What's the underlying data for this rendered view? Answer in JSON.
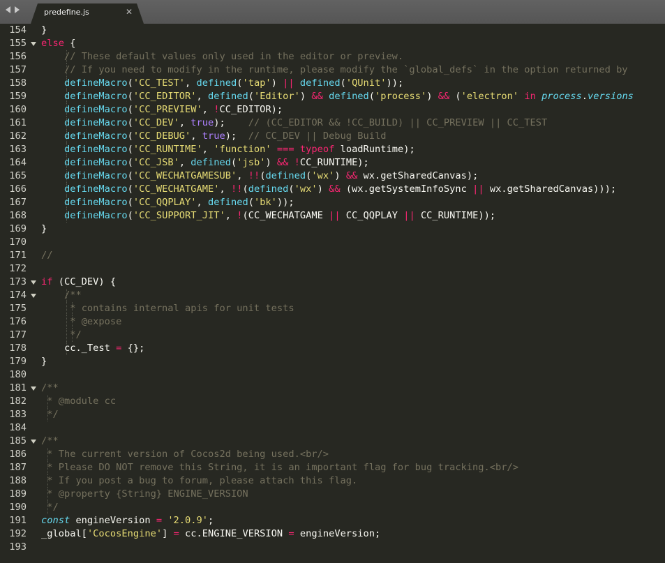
{
  "tab": {
    "title": "predefine.js"
  },
  "colors": {
    "background": "#272822",
    "keyword": "#f92672",
    "string": "#e6db74",
    "comment": "#75715e",
    "function": "#66d9ef",
    "constant": "#ae81ff",
    "text": "#f8f8f2"
  },
  "icons": [
    "nav-back-icon",
    "nav-forward-icon",
    "close-icon",
    "fold-arrow-icon"
  ],
  "lines": [
    {
      "n": "154",
      "fold": false,
      "guides": 0,
      "tokens": [
        [
          "w",
          "}"
        ]
      ]
    },
    {
      "n": "155",
      "fold": true,
      "guides": 0,
      "tokens": [
        [
          "k",
          "else"
        ],
        [
          "w",
          " {"
        ]
      ]
    },
    {
      "n": "156",
      "fold": false,
      "guides": 1,
      "tokens": [
        [
          "w",
          "    "
        ],
        [
          "c",
          "// These default values only used in the editor or preview."
        ]
      ]
    },
    {
      "n": "157",
      "fold": false,
      "guides": 1,
      "tokens": [
        [
          "w",
          "    "
        ],
        [
          "c",
          "// If you need to modify in the runtime, please modify the `global_defs` in the option returned by"
        ]
      ]
    },
    {
      "n": "158",
      "fold": false,
      "guides": 1,
      "tokens": [
        [
          "w",
          "    "
        ],
        [
          "f",
          "defineMacro"
        ],
        [
          "w",
          "("
        ],
        [
          "s",
          "'CC_TEST'"
        ],
        [
          "w",
          ", "
        ],
        [
          "f",
          "defined"
        ],
        [
          "w",
          "("
        ],
        [
          "s",
          "'tap'"
        ],
        [
          "w",
          ") "
        ],
        [
          "k",
          "||"
        ],
        [
          "w",
          " "
        ],
        [
          "f",
          "defined"
        ],
        [
          "w",
          "("
        ],
        [
          "s",
          "'QUnit'"
        ],
        [
          "w",
          "));"
        ]
      ]
    },
    {
      "n": "159",
      "fold": false,
      "guides": 1,
      "tokens": [
        [
          "w",
          "    "
        ],
        [
          "f",
          "defineMacro"
        ],
        [
          "w",
          "("
        ],
        [
          "s",
          "'CC_EDITOR'"
        ],
        [
          "w",
          ", "
        ],
        [
          "f",
          "defined"
        ],
        [
          "w",
          "("
        ],
        [
          "s",
          "'Editor'"
        ],
        [
          "w",
          ") "
        ],
        [
          "k",
          "&&"
        ],
        [
          "w",
          " "
        ],
        [
          "f",
          "defined"
        ],
        [
          "w",
          "("
        ],
        [
          "s",
          "'process'"
        ],
        [
          "w",
          ") "
        ],
        [
          "k",
          "&&"
        ],
        [
          "w",
          " ("
        ],
        [
          "s",
          "'electron'"
        ],
        [
          "w",
          " "
        ],
        [
          "k",
          "in"
        ],
        [
          "w",
          " "
        ],
        [
          "it",
          "process"
        ],
        [
          "w",
          "."
        ],
        [
          "it",
          "versions"
        ]
      ]
    },
    {
      "n": "160",
      "fold": false,
      "guides": 1,
      "tokens": [
        [
          "w",
          "    "
        ],
        [
          "f",
          "defineMacro"
        ],
        [
          "w",
          "("
        ],
        [
          "s",
          "'CC_PREVIEW'"
        ],
        [
          "w",
          ", "
        ],
        [
          "k",
          "!"
        ],
        [
          "w",
          "CC_EDITOR);"
        ]
      ]
    },
    {
      "n": "161",
      "fold": false,
      "guides": 1,
      "tokens": [
        [
          "w",
          "    "
        ],
        [
          "f",
          "defineMacro"
        ],
        [
          "w",
          "("
        ],
        [
          "s",
          "'CC_DEV'"
        ],
        [
          "w",
          ", "
        ],
        [
          "b",
          "true"
        ],
        [
          "w",
          ");    "
        ],
        [
          "c",
          "// (CC_EDITOR && !CC_BUILD) || CC_PREVIEW || CC_TEST"
        ]
      ]
    },
    {
      "n": "162",
      "fold": false,
      "guides": 1,
      "tokens": [
        [
          "w",
          "    "
        ],
        [
          "f",
          "defineMacro"
        ],
        [
          "w",
          "("
        ],
        [
          "s",
          "'CC_DEBUG'"
        ],
        [
          "w",
          ", "
        ],
        [
          "b",
          "true"
        ],
        [
          "w",
          ");  "
        ],
        [
          "c",
          "// CC_DEV || Debug Build"
        ]
      ]
    },
    {
      "n": "163",
      "fold": false,
      "guides": 1,
      "tokens": [
        [
          "w",
          "    "
        ],
        [
          "f",
          "defineMacro"
        ],
        [
          "w",
          "("
        ],
        [
          "s",
          "'CC_RUNTIME'"
        ],
        [
          "w",
          ", "
        ],
        [
          "s",
          "'function'"
        ],
        [
          "w",
          " "
        ],
        [
          "k",
          "==="
        ],
        [
          "w",
          " "
        ],
        [
          "k",
          "typeof"
        ],
        [
          "w",
          " loadRuntime);"
        ]
      ]
    },
    {
      "n": "164",
      "fold": false,
      "guides": 1,
      "tokens": [
        [
          "w",
          "    "
        ],
        [
          "f",
          "defineMacro"
        ],
        [
          "w",
          "("
        ],
        [
          "s",
          "'CC_JSB'"
        ],
        [
          "w",
          ", "
        ],
        [
          "f",
          "defined"
        ],
        [
          "w",
          "("
        ],
        [
          "s",
          "'jsb'"
        ],
        [
          "w",
          ") "
        ],
        [
          "k",
          "&&"
        ],
        [
          "w",
          " "
        ],
        [
          "k",
          "!"
        ],
        [
          "w",
          "CC_RUNTIME);"
        ]
      ]
    },
    {
      "n": "165",
      "fold": false,
      "guides": 1,
      "tokens": [
        [
          "w",
          "    "
        ],
        [
          "f",
          "defineMacro"
        ],
        [
          "w",
          "("
        ],
        [
          "s",
          "'CC_WECHATGAMESUB'"
        ],
        [
          "w",
          ", "
        ],
        [
          "k",
          "!!"
        ],
        [
          "w",
          "("
        ],
        [
          "f",
          "defined"
        ],
        [
          "w",
          "("
        ],
        [
          "s",
          "'wx'"
        ],
        [
          "w",
          ") "
        ],
        [
          "k",
          "&&"
        ],
        [
          "w",
          " wx.getSharedCanvas);"
        ]
      ]
    },
    {
      "n": "166",
      "fold": false,
      "guides": 1,
      "tokens": [
        [
          "w",
          "    "
        ],
        [
          "f",
          "defineMacro"
        ],
        [
          "w",
          "("
        ],
        [
          "s",
          "'CC_WECHATGAME'"
        ],
        [
          "w",
          ", "
        ],
        [
          "k",
          "!!"
        ],
        [
          "w",
          "("
        ],
        [
          "f",
          "defined"
        ],
        [
          "w",
          "("
        ],
        [
          "s",
          "'wx'"
        ],
        [
          "w",
          ") "
        ],
        [
          "k",
          "&&"
        ],
        [
          "w",
          " (wx.getSystemInfoSync "
        ],
        [
          "k",
          "||"
        ],
        [
          "w",
          " wx.getSharedCanvas)));"
        ]
      ]
    },
    {
      "n": "167",
      "fold": false,
      "guides": 1,
      "tokens": [
        [
          "w",
          "    "
        ],
        [
          "f",
          "defineMacro"
        ],
        [
          "w",
          "("
        ],
        [
          "s",
          "'CC_QQPLAY'"
        ],
        [
          "w",
          ", "
        ],
        [
          "f",
          "defined"
        ],
        [
          "w",
          "("
        ],
        [
          "s",
          "'bk'"
        ],
        [
          "w",
          "));"
        ]
      ]
    },
    {
      "n": "168",
      "fold": false,
      "guides": 1,
      "tokens": [
        [
          "w",
          "    "
        ],
        [
          "f",
          "defineMacro"
        ],
        [
          "w",
          "("
        ],
        [
          "s",
          "'CC_SUPPORT_JIT'"
        ],
        [
          "w",
          ", "
        ],
        [
          "k",
          "!"
        ],
        [
          "w",
          "(CC_WECHATGAME "
        ],
        [
          "k",
          "||"
        ],
        [
          "w",
          " CC_QQPLAY "
        ],
        [
          "k",
          "||"
        ],
        [
          "w",
          " CC_RUNTIME));"
        ]
      ]
    },
    {
      "n": "169",
      "fold": false,
      "guides": 0,
      "tokens": [
        [
          "w",
          "}"
        ]
      ]
    },
    {
      "n": "170",
      "fold": false,
      "guides": 0,
      "tokens": []
    },
    {
      "n": "171",
      "fold": false,
      "guides": 0,
      "tokens": [
        [
          "c",
          "//"
        ]
      ]
    },
    {
      "n": "172",
      "fold": false,
      "guides": 0,
      "tokens": []
    },
    {
      "n": "173",
      "fold": true,
      "guides": 0,
      "tokens": [
        [
          "k",
          "if"
        ],
        [
          "w",
          " (CC_DEV) {"
        ]
      ]
    },
    {
      "n": "174",
      "fold": true,
      "guides": 1,
      "tokens": [
        [
          "w",
          "    "
        ],
        [
          "c",
          "/**"
        ]
      ]
    },
    {
      "n": "175",
      "fold": false,
      "guides": 2,
      "tokens": [
        [
          "w",
          "    "
        ],
        [
          "c",
          " * contains internal apis for unit tests"
        ]
      ]
    },
    {
      "n": "176",
      "fold": false,
      "guides": 2,
      "tokens": [
        [
          "w",
          "    "
        ],
        [
          "c",
          " * @expose"
        ]
      ]
    },
    {
      "n": "177",
      "fold": false,
      "guides": 2,
      "tokens": [
        [
          "w",
          "    "
        ],
        [
          "c",
          " */"
        ]
      ]
    },
    {
      "n": "178",
      "fold": false,
      "guides": 1,
      "tokens": [
        [
          "w",
          "    cc._Test "
        ],
        [
          "k",
          "="
        ],
        [
          "w",
          " {};"
        ]
      ]
    },
    {
      "n": "179",
      "fold": false,
      "guides": 0,
      "tokens": [
        [
          "w",
          "}"
        ]
      ]
    },
    {
      "n": "180",
      "fold": false,
      "guides": 0,
      "tokens": []
    },
    {
      "n": "181",
      "fold": true,
      "guides": 0,
      "tokens": [
        [
          "c",
          "/**"
        ]
      ]
    },
    {
      "n": "182",
      "fold": false,
      "guides": 3,
      "tokens": [
        [
          "c",
          " * @module cc"
        ]
      ]
    },
    {
      "n": "183",
      "fold": false,
      "guides": 3,
      "tokens": [
        [
          "c",
          " */"
        ]
      ]
    },
    {
      "n": "184",
      "fold": false,
      "guides": 0,
      "tokens": []
    },
    {
      "n": "185",
      "fold": true,
      "guides": 0,
      "tokens": [
        [
          "c",
          "/**"
        ]
      ]
    },
    {
      "n": "186",
      "fold": false,
      "guides": 3,
      "tokens": [
        [
          "c",
          " * The current version of Cocos2d being used.<br/>"
        ]
      ]
    },
    {
      "n": "187",
      "fold": false,
      "guides": 3,
      "tokens": [
        [
          "c",
          " * Please DO NOT remove this String, it is an important flag for bug tracking.<br/>"
        ]
      ]
    },
    {
      "n": "188",
      "fold": false,
      "guides": 3,
      "tokens": [
        [
          "c",
          " * If you post a bug to forum, please attach this flag."
        ]
      ]
    },
    {
      "n": "189",
      "fold": false,
      "guides": 3,
      "tokens": [
        [
          "c",
          " * @property {String} ENGINE_VERSION"
        ]
      ]
    },
    {
      "n": "190",
      "fold": false,
      "guides": 3,
      "tokens": [
        [
          "c",
          " */"
        ]
      ]
    },
    {
      "n": "191",
      "fold": false,
      "guides": 0,
      "tokens": [
        [
          "it",
          "const"
        ],
        [
          "w",
          " engineVersion "
        ],
        [
          "k",
          "="
        ],
        [
          "w",
          " "
        ],
        [
          "s",
          "'2.0.9'"
        ],
        [
          "w",
          ";"
        ]
      ]
    },
    {
      "n": "192",
      "fold": false,
      "guides": 0,
      "tokens": [
        [
          "w",
          "_global["
        ],
        [
          "s",
          "'CocosEngine'"
        ],
        [
          "w",
          "] "
        ],
        [
          "k",
          "="
        ],
        [
          "w",
          " cc.ENGINE_VERSION "
        ],
        [
          "k",
          "="
        ],
        [
          "w",
          " engineVersion;"
        ]
      ]
    },
    {
      "n": "193",
      "fold": false,
      "guides": 0,
      "tokens": []
    }
  ]
}
